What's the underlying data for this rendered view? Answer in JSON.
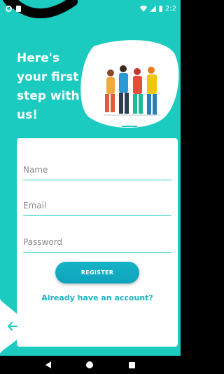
{
  "status_bar": {
    "time": "2:2"
  },
  "headline": {
    "line1": "Here's",
    "line2": "your first",
    "line3": "step with",
    "line4": "us!"
  },
  "form": {
    "name_placeholder": "Name",
    "email_placeholder": "Email",
    "password_placeholder": "Password",
    "register_label": "REGISTER",
    "login_link": "Already have an account?"
  },
  "colors": {
    "background": "#1ccbc0",
    "accent": "#15b6c6",
    "button": "#0ea3bd",
    "card": "#ffffff"
  },
  "icons": {
    "back": "arrow-left-icon",
    "nav_back": "triangle-back-icon",
    "nav_home": "circle-home-icon",
    "nav_recent": "square-recent-icon"
  }
}
